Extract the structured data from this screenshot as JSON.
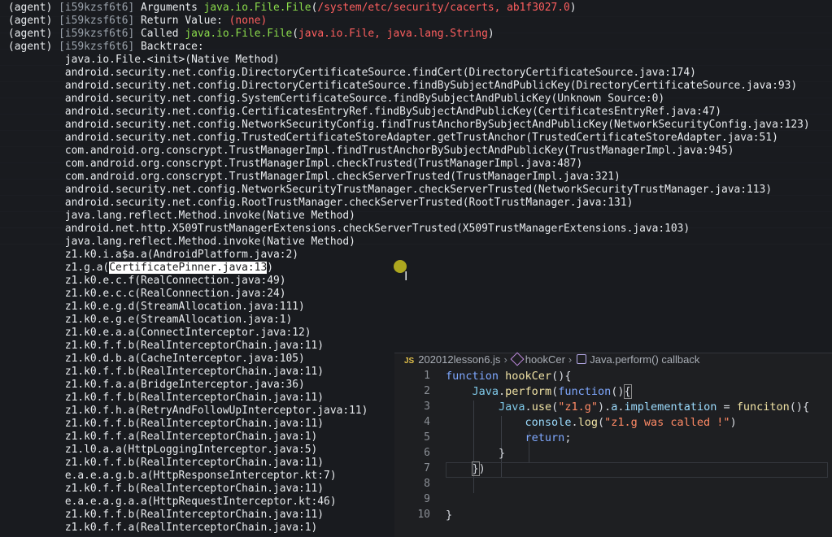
{
  "terminal": {
    "header": [
      {
        "prefix": "(agent)",
        "session": "[i59kzsf6t6]",
        "label": "Arguments",
        "green": "java.io.File.File",
        "paren_open": "(",
        "red": "/system/etc/security/cacerts, ab1f3027.0",
        "paren_close": ")"
      },
      {
        "prefix": "(agent)",
        "session": "[i59kzsf6t6]",
        "label": "Return Value:",
        "red": "(none)"
      },
      {
        "prefix": "(agent)",
        "session": "[i59kzsf6t6]",
        "label": "Called",
        "green": "java.io.File.File",
        "paren_open": "(",
        "red": "java.io.File, java.lang.String",
        "paren_close": ")"
      },
      {
        "prefix": "(agent)",
        "session": "[i59kzsf6t6]",
        "label": "Backtrace:"
      }
    ],
    "backtrace": [
      "java.io.File.<init>(Native Method)",
      "android.security.net.config.DirectoryCertificateSource.findCert(DirectoryCertificateSource.java:174)",
      "android.security.net.config.DirectoryCertificateSource.findBySubjectAndPublicKey(DirectoryCertificateSource.java:93)",
      "android.security.net.config.SystemCertificateSource.findBySubjectAndPublicKey(Unknown Source:0)",
      "android.security.net.config.CertificatesEntryRef.findBySubjectAndPublicKey(CertificatesEntryRef.java:47)",
      "android.security.net.config.NetworkSecurityConfig.findTrustAnchorBySubjectAndPublicKey(NetworkSecurityConfig.java:123)",
      "android.security.net.config.TrustedCertificateStoreAdapter.getTrustAnchor(TrustedCertificateStoreAdapter.java:51)",
      "com.android.org.conscrypt.TrustManagerImpl.findTrustAnchorBySubjectAndPublicKey(TrustManagerImpl.java:945)",
      "com.android.org.conscrypt.TrustManagerImpl.checkTrusted(TrustManagerImpl.java:487)",
      "com.android.org.conscrypt.TrustManagerImpl.checkServerTrusted(TrustManagerImpl.java:321)",
      "android.security.net.config.NetworkSecurityTrustManager.checkServerTrusted(NetworkSecurityTrustManager.java:113)",
      "android.security.net.config.RootTrustManager.checkServerTrusted(RootTrustManager.java:131)",
      "java.lang.reflect.Method.invoke(Native Method)",
      "android.net.http.X509TrustManagerExtensions.checkServerTrusted(X509TrustManagerExtensions.java:103)",
      "java.lang.reflect.Method.invoke(Native Method)",
      "z1.k0.i.a$a.a(AndroidPlatform.java:2)",
      {
        "before": "z1.g.a(",
        "highlight": "CertificatePinner.java:13",
        "after": ")"
      },
      "z1.k0.e.c.f(RealConnection.java:49)",
      "z1.k0.e.c.c(RealConnection.java:24)",
      "z1.k0.e.g.d(StreamAllocation.java:111)",
      "z1.k0.e.g.e(StreamAllocation.java:1)",
      "z1.k0.e.a.a(ConnectInterceptor.java:12)",
      "z1.k0.f.f.b(RealInterceptorChain.java:11)",
      "z1.k0.d.b.a(CacheInterceptor.java:105)",
      "z1.k0.f.f.b(RealInterceptorChain.java:11)",
      "z1.k0.f.a.a(BridgeInterceptor.java:36)",
      "z1.k0.f.f.b(RealInterceptorChain.java:11)",
      "z1.k0.f.h.a(RetryAndFollowUpInterceptor.java:11)",
      "z1.k0.f.f.b(RealInterceptorChain.java:11)",
      "z1.k0.f.f.a(RealInterceptorChain.java:1)",
      "z1.l0.a.a(HttpLoggingInterceptor.java:5)",
      "z1.k0.f.f.b(RealInterceptorChain.java:11)",
      "e.a.e.a.g.b.a(HttpResponseInterceptor.kt:7)",
      "z1.k0.f.f.b(RealInterceptorChain.java:11)",
      "e.a.e.a.g.a.a(HttpRequestInterceptor.kt:46)",
      "z1.k0.f.f.b(RealInterceptorChain.java:11)",
      "z1.k0.f.f.a(RealInterceptorChain.java:1)"
    ]
  },
  "editor": {
    "breadcrumb": {
      "lang_badge": "JS",
      "file": "202012lesson6.js",
      "symbol1": "hookCer",
      "symbol2": "Java.perform() callback"
    },
    "line_numbers": [
      "1",
      "2",
      "3",
      "4",
      "5",
      "6",
      "7",
      "8",
      "9",
      "10"
    ],
    "code": {
      "l1_kw": "function",
      "l1_fn": "hookCer",
      "l1_rest": "(){",
      "l2_obj": "Java",
      "l2_dot": ".",
      "l2_fn": "perform",
      "l2_p": "(",
      "l2_kw": "function",
      "l2_rest": "()",
      "l2_brace": "{",
      "l3_obj": "Java",
      "l3_dot": ".",
      "l3_fn": "use",
      "l3_p1": "(",
      "l3_str": "\"z1.g\"",
      "l3_p2": ").",
      "l3_prop1": "a",
      "l3_dot2": ".",
      "l3_prop2": "implementation",
      "l3_eq": " = ",
      "l3_call": "funciton",
      "l3_rest": "(){",
      "l4_obj": "console",
      "l4_dot": ".",
      "l4_fn": "log",
      "l4_p1": "(",
      "l4_str": "\"z1.g was called !\"",
      "l4_p2": ")",
      "l5_kw": "return",
      "l5_semi": ";",
      "l6_close": "}",
      "l7_brace": "}",
      "l7_paren": ")",
      "l10_close": "}"
    }
  }
}
